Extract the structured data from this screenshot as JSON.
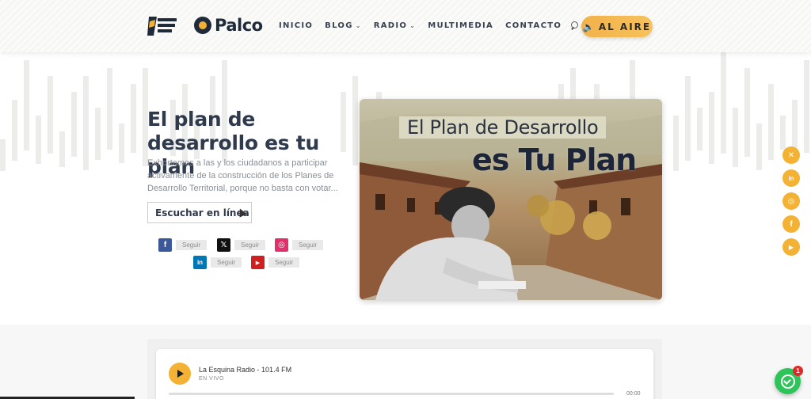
{
  "header": {
    "brand": "Palco",
    "nav": [
      {
        "label": "INICIO",
        "dropdown": false
      },
      {
        "label": "BLOG",
        "dropdown": true
      },
      {
        "label": "RADIO",
        "dropdown": true
      },
      {
        "label": "MULTIMEDIA",
        "dropdown": false
      },
      {
        "label": "CONTACTO",
        "dropdown": false
      }
    ],
    "on_air_label": "AL AIRE",
    "icons": {
      "search": "search-icon",
      "on_air": "speaker-icon"
    }
  },
  "hero": {
    "title": "El plan de desarrollo es tu plan",
    "description": "Exhortamos a las y los ciudadanos a participar activamente de la construcción de los Planes de Desarrollo Territorial, porque no basta con votar...",
    "listen_button": "Escuchar en línea",
    "image_text_line1": "El Plan de Desarrollo",
    "image_text_line2": "es Tu Plan"
  },
  "social_follow": [
    {
      "network": "facebook",
      "glyph": "f",
      "color": "#3b5998",
      "label": "Seguir"
    },
    {
      "network": "x",
      "glyph": "𝕏",
      "color": "#111111",
      "label": "Seguir"
    },
    {
      "network": "instagram",
      "glyph": "◎",
      "color": "#e1306c",
      "label": "Seguir"
    },
    {
      "network": "linkedin",
      "glyph": "in",
      "color": "#0077b5",
      "label": "Seguir"
    },
    {
      "network": "youtube",
      "glyph": "▶",
      "color": "#cd201f",
      "label": "Seguir"
    }
  ],
  "floating_social": [
    {
      "network": "x",
      "glyph": "✕"
    },
    {
      "network": "linkedin",
      "glyph": "in"
    },
    {
      "network": "instagram",
      "glyph": "◎"
    },
    {
      "network": "facebook",
      "glyph": "f"
    },
    {
      "network": "youtube",
      "glyph": "▶"
    }
  ],
  "player": {
    "station": "La Esquina Radio - 101.4 FM",
    "status": "EN VIVO",
    "time": "00:00"
  },
  "whatsapp": {
    "badge": "1"
  },
  "colors": {
    "accent": "#f3b233",
    "title": "#2f3a4c",
    "whatsapp": "#2dc45a"
  }
}
